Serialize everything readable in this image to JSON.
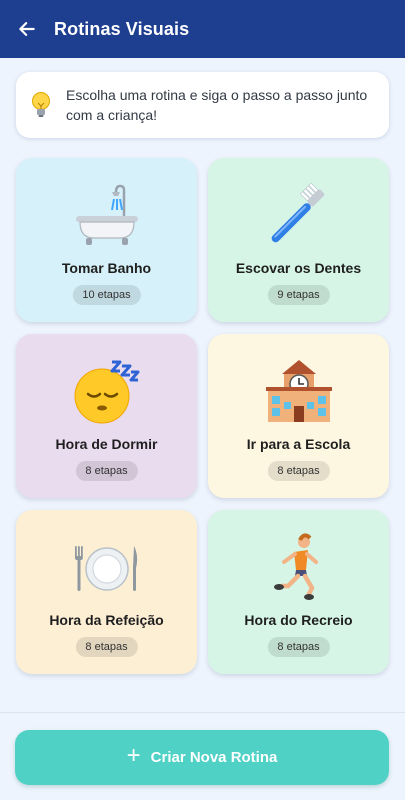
{
  "header": {
    "title": "Rotinas Visuais",
    "back_icon": "arrow-left-icon",
    "background": "#1e3f8f"
  },
  "tip": {
    "icon": "lightbulb-icon",
    "text": "Escolha uma rotina e siga o passo a passo junto com a criança!"
  },
  "routines": [
    {
      "title": "Tomar Banho",
      "steps": "10 etapas",
      "icon": "bathtub-icon",
      "color": "#d6f1f9"
    },
    {
      "title": "Escovar os Dentes",
      "steps": "9 etapas",
      "icon": "toothbrush-icon",
      "color": "#d6f5e6"
    },
    {
      "title": "Hora de Dormir",
      "steps": "8 etapas",
      "icon": "sleeping-face-icon",
      "color": "#e9dcef"
    },
    {
      "title": "Ir para a Escola",
      "steps": "8 etapas",
      "icon": "school-icon",
      "color": "#fdf6e0"
    },
    {
      "title": "Hora da Refeição",
      "steps": "8 etapas",
      "icon": "plate-cutlery-icon",
      "color": "#fcefd4"
    },
    {
      "title": "Hora do Recreio",
      "steps": "8 etapas",
      "icon": "running-person-icon",
      "color": "#d6f5e6"
    }
  ],
  "footer": {
    "create_label": "Criar Nova Rotina",
    "create_icon": "plus-icon",
    "button_color": "#4fd1c5"
  }
}
